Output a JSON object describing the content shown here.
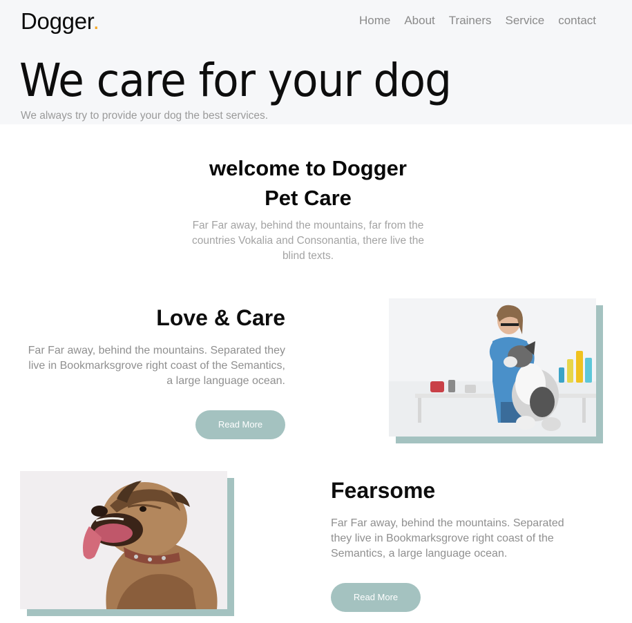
{
  "brand": {
    "name": "Dogger",
    "dot": ".",
    "accent": "#f5a623"
  },
  "nav": {
    "items": [
      "Home",
      "About",
      "Trainers",
      "Service",
      "contact"
    ]
  },
  "hero": {
    "title": "We care for your dog",
    "subtitle": "We always try to provide your dog the best services."
  },
  "welcome": {
    "title_line1": "welcome to Dogger",
    "title_line2": "Pet Care",
    "text": "Far Far away, behind the mountains, far from the countries Vokalia and Consonantia, there live the blind texts."
  },
  "features": [
    {
      "title": "Love & Care",
      "text": "Far Far away, behind the mountains. Separated they live in Bookmarksgrove right coast of the Semantics, a large language ocean.",
      "button": "Read More",
      "image_icon": "vet-with-dog-photo"
    },
    {
      "title": "Fearsome",
      "text": "Far Far away, behind the mountains. Separated they live in Bookmarksgrove right coast of the Semantics, a large language ocean.",
      "button": "Read More",
      "image_icon": "bulldog-photo"
    }
  ],
  "colors": {
    "button": "#a4c2c0",
    "hero_bg": "#f6f7f9",
    "text_muted": "#8f8f8f"
  }
}
